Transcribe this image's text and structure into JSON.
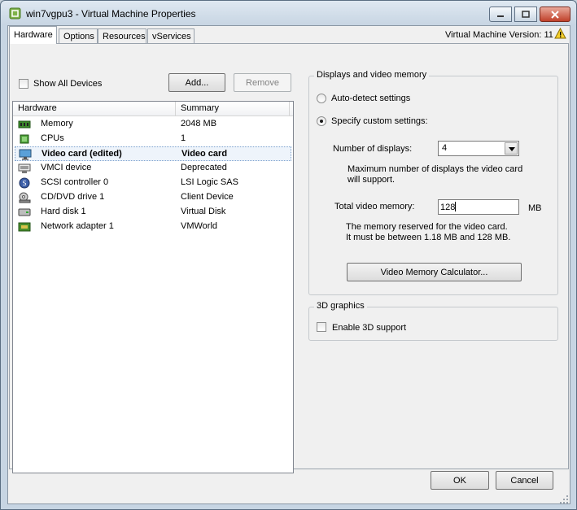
{
  "window": {
    "title": "win7vgpu3 - Virtual Machine Properties",
    "controls": {
      "minimize": "minimize",
      "maximize": "maximize",
      "close": "close"
    }
  },
  "tabs": [
    {
      "label": "Hardware",
      "active": true
    },
    {
      "label": "Options",
      "active": false
    },
    {
      "label": "Resources",
      "active": false
    },
    {
      "label": "vServices",
      "active": false
    }
  ],
  "version_label": "Virtual Machine Version: 11",
  "show_all_devices": {
    "label": "Show All Devices",
    "checked": false
  },
  "buttons": {
    "add": "Add...",
    "remove": "Remove",
    "ok": "OK",
    "cancel": "Cancel",
    "calculator": "Video Memory Calculator..."
  },
  "hardware_list": {
    "columns": [
      "Hardware",
      "Summary"
    ],
    "rows": [
      {
        "icon": "memory-icon",
        "name": "Memory",
        "summary": "2048 MB",
        "selected": false
      },
      {
        "icon": "cpu-icon",
        "name": "CPUs",
        "summary": "1",
        "selected": false
      },
      {
        "icon": "monitor-icon",
        "name": "Video card  (edited)",
        "summary": "Video card",
        "selected": true
      },
      {
        "icon": "vmci-icon",
        "name": "VMCI device",
        "summary": "Deprecated",
        "selected": false
      },
      {
        "icon": "scsi-icon",
        "name": "SCSI controller 0",
        "summary": "LSI Logic SAS",
        "selected": false
      },
      {
        "icon": "cd-icon",
        "name": "CD/DVD drive 1",
        "summary": "Client Device",
        "selected": false
      },
      {
        "icon": "disk-icon",
        "name": "Hard disk 1",
        "summary": "Virtual Disk",
        "selected": false
      },
      {
        "icon": "network-icon",
        "name": "Network adapter 1",
        "summary": "VMWorld",
        "selected": false
      }
    ]
  },
  "displays_group": {
    "title": "Displays and video memory",
    "auto_detect": {
      "label": "Auto-detect settings",
      "selected": false
    },
    "custom": {
      "label": "Specify custom settings:",
      "selected": true
    },
    "num_displays_label": "Number of displays:",
    "num_displays_value": "4",
    "num_displays_note_1": "Maximum number of displays the video card",
    "num_displays_note_2": "will support.",
    "total_memory_label": "Total video memory:",
    "total_memory_value": "128",
    "memory_unit": "MB",
    "memory_note_1": "The memory reserved for the video card.",
    "memory_note_2": "It must be between 1.18 MB and 128 MB."
  },
  "graphics3d_group": {
    "title": "3D graphics",
    "enable": {
      "label": "Enable 3D support",
      "checked": false
    }
  }
}
